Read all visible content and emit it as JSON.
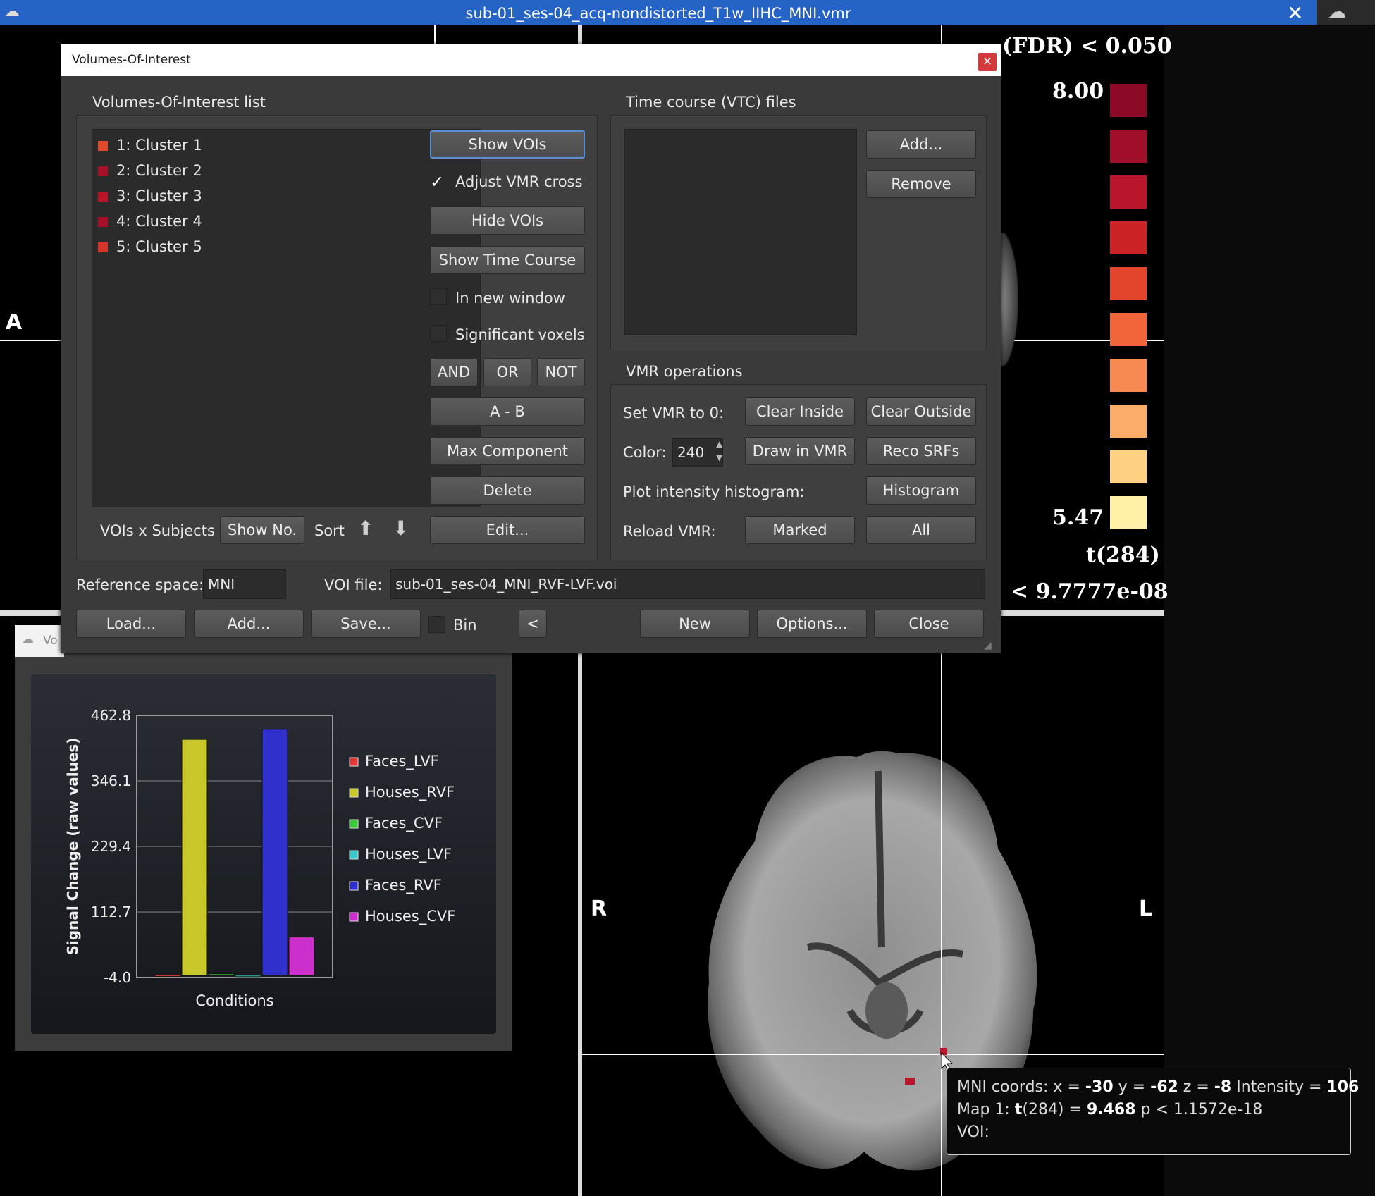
{
  "window": {
    "title": "sub-01_ses-04_acq-nondistorted_T1w_IIHC_MNI.vmr"
  },
  "dialog": {
    "title": "Volumes-Of-Interest",
    "voi_list_label": "Volumes-Of-Interest list",
    "voi_items": [
      {
        "label": "1: Cluster 1",
        "color": "#e04a2a"
      },
      {
        "label": "2: Cluster 2",
        "color": "#a8102a"
      },
      {
        "label": "3: Cluster 3",
        "color": "#b81428"
      },
      {
        "label": "4: Cluster 4",
        "color": "#a8102a"
      },
      {
        "label": "5: Cluster 5",
        "color": "#d8342a"
      }
    ],
    "buttons": {
      "show_vois": "Show VOIs",
      "adjust_vmr_cross": "Adjust VMR cross",
      "hide_vois": "Hide VOIs",
      "show_time_course": "Show Time Course",
      "in_new_window": "In new window",
      "significant_voxels": "Significant voxels",
      "and": "AND",
      "or": "OR",
      "not": "NOT",
      "a_minus_b": "A - B",
      "max_component": "Max Component",
      "delete": "Delete",
      "edit": "Edit..."
    },
    "vois_x_subjects": "VOIs x Subjects",
    "show_no": "Show No.",
    "sort": "Sort",
    "vtc_label": "Time course (VTC) files",
    "vtc_add": "Add...",
    "vtc_remove": "Remove",
    "vmr_ops_label": "VMR operations",
    "set_vmr_to_0": "Set VMR to 0:",
    "clear_inside": "Clear Inside",
    "clear_outside": "Clear Outside",
    "color_label": "Color:",
    "color_value": "240",
    "draw_in_vmr": "Draw in VMR",
    "reco_srfs": "Reco SRFs",
    "plot_hist_label": "Plot intensity histogram:",
    "histogram": "Histogram",
    "reload_vmr": "Reload VMR:",
    "marked": "Marked",
    "all": "All",
    "ref_space_label": "Reference space:",
    "ref_space_value": "MNI",
    "voi_file_label": "VOI file:",
    "voi_file_value": "sub-01_ses-04_MNI_RVF-LVF.voi",
    "load": "Load...",
    "add": "Add...",
    "save": "Save...",
    "bin": "Bin",
    "back": "<",
    "new": "New",
    "options": "Options...",
    "close": "Close"
  },
  "colorbar": {
    "header": "(FDR) < 0.050",
    "max": "8.00",
    "min": "5.47",
    "stat": "t(284)",
    "pval": "< 9.7777e-08",
    "colors": [
      "#8c0a26",
      "#a10e2a",
      "#b8162a",
      "#cc2326",
      "#e2452c",
      "#f0653a",
      "#f78a52",
      "#fbac68",
      "#fdd283",
      "#fff1a6"
    ]
  },
  "views": {
    "left_a": "A",
    "right_r": "R",
    "right_l": "L"
  },
  "plot": {
    "tab": "Vo",
    "legend": [
      "Faces_LVF",
      "Houses_RVF",
      "Faces_CVF",
      "Houses_LVF",
      "Faces_RVF",
      "Houses_CVF"
    ]
  },
  "chart_data": {
    "type": "bar",
    "xlabel": "Conditions",
    "ylabel": "Signal Change (raw values)",
    "ylim": [
      -4.0,
      462.8
    ],
    "yticks": [
      "462.8",
      "346.1",
      "229.4",
      "112.7",
      "-4.0"
    ],
    "series": [
      {
        "name": "Faces_LVF",
        "value": 0.5,
        "color": "#e03a3a"
      },
      {
        "name": "Houses_RVF",
        "value": 420.0,
        "color": "#c8c82a"
      },
      {
        "name": "Faces_CVF",
        "value": 2.5,
        "color": "#3ac83a"
      },
      {
        "name": "Houses_LVF",
        "value": -1.5,
        "color": "#3ac8c8"
      },
      {
        "name": "Faces_RVF",
        "value": 438.0,
        "color": "#3030cc"
      },
      {
        "name": "Houses_CVF",
        "value": 68.0,
        "color": "#cc30cc"
      }
    ]
  },
  "tooltip": {
    "l1_prefix": "MNI coords: x = ",
    "x": "-30",
    "y_label": " y = ",
    "y": "-62",
    "z_label": " z = ",
    "z": "-8",
    "int_label": "  Intensity = ",
    "intensity": "106",
    "l2_prefix": "Map 1: ",
    "stat": "t",
    "df": "(284) = ",
    "tval": "9.468",
    "p": "  p < 1.1572e-18",
    "l3": "VOI:"
  }
}
